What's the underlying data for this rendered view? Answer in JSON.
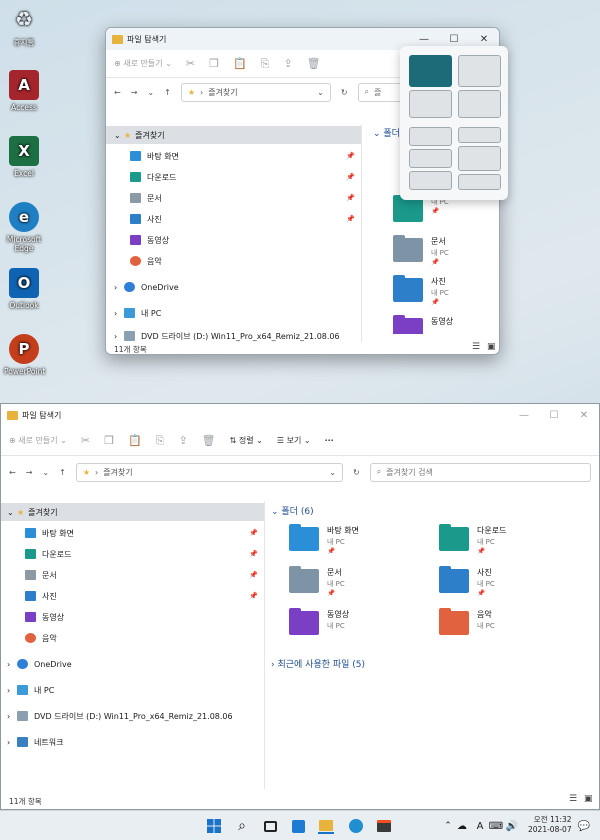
{
  "desktop": {
    "icons": [
      {
        "label": "휴지통",
        "glyph": "♻"
      },
      {
        "label": "Access",
        "glyph": "A"
      },
      {
        "label": "Excel",
        "glyph": "X"
      },
      {
        "label": "Microsoft Edge",
        "glyph": "e"
      },
      {
        "label": "Outlook",
        "glyph": "O"
      },
      {
        "label": "PowerPoint",
        "glyph": "P"
      }
    ]
  },
  "small_window": {
    "title": "파일 탐색기",
    "toolbar": {
      "new_label": "새로 만들기"
    },
    "address": "즐겨찾기",
    "search_placeholder": "즐",
    "nav": {
      "favorites": "즐겨찾기",
      "items": [
        "바탕 화면",
        "다운로드",
        "문서",
        "사진",
        "동영상",
        "음악"
      ],
      "onedrive": "OneDrive",
      "thispc": "내 PC",
      "dvd": "DVD 드라이브 (D:) Win11_Pro_x64_Remiz_21.08.06"
    },
    "section_label": "폴더",
    "folders": [
      {
        "name": "",
        "sub": "내 PC"
      },
      {
        "name": "문서",
        "sub": "내 PC"
      },
      {
        "name": "사진",
        "sub": "내 PC"
      },
      {
        "name": "동영상",
        "sub": ""
      }
    ],
    "status": "11개 항목"
  },
  "big_window": {
    "title": "파일 탐색기",
    "toolbar": {
      "new_label": "새로 만들기",
      "sort_label": "정렬",
      "view_label": "보기",
      "more_label": "···"
    },
    "address": "즐겨찾기",
    "search_placeholder": "즐겨찾기 검색",
    "nav": {
      "favorites": "즐겨찾기",
      "items": [
        "바탕 화면",
        "다운로드",
        "문서",
        "사진",
        "동영상",
        "음악"
      ],
      "onedrive": "OneDrive",
      "thispc": "내 PC",
      "dvd": "DVD 드라이브 (D:) Win11_Pro_x64_Remiz_21.08.06",
      "network": "네트워크"
    },
    "folders_section": "폴더 (6)",
    "folders": [
      {
        "name": "바탕 화면",
        "sub": "내 PC"
      },
      {
        "name": "다운로드",
        "sub": "내 PC"
      },
      {
        "name": "문서",
        "sub": "내 PC"
      },
      {
        "name": "사진",
        "sub": "내 PC"
      },
      {
        "name": "동영상",
        "sub": "내 PC"
      },
      {
        "name": "음악",
        "sub": "내 PC"
      }
    ],
    "recent_section": "최근에 사용한 파일 (5)",
    "status": "11개 항목"
  },
  "taskbar": {
    "tray_lang": "A",
    "time": "오전 11:32",
    "date": "2021-08-07"
  },
  "colors": {
    "accent": "#1c6b78",
    "section_blue": "#1f4e8c",
    "selected": "#dcdfe3"
  }
}
